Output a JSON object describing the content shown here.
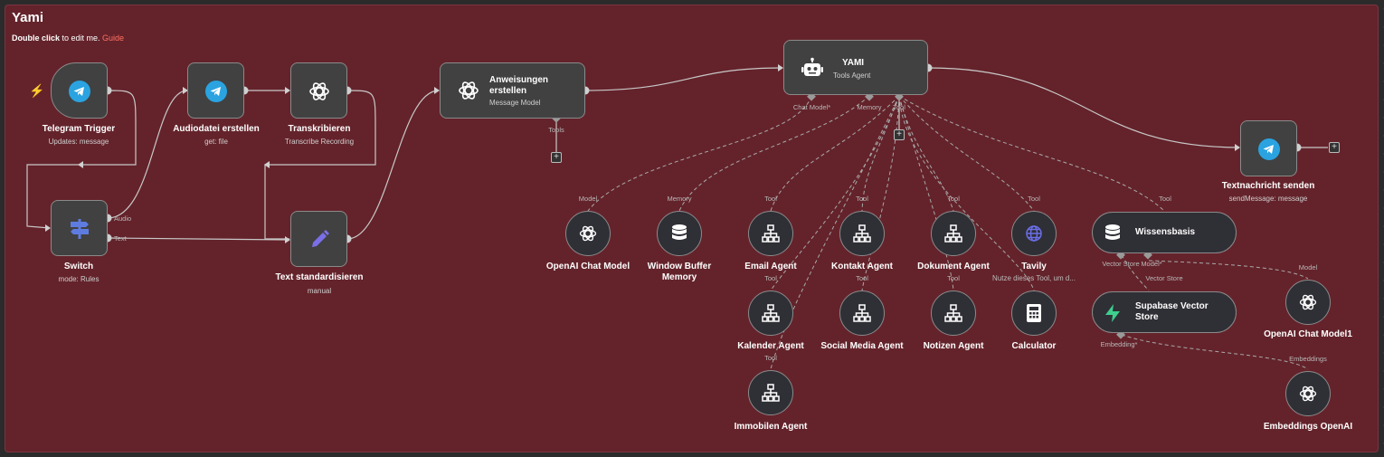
{
  "sticky": {
    "title": "Yami",
    "sub_prefix_bold": "Double click",
    "sub_middle": " to edit me. ",
    "sub_link": "Guide"
  },
  "nodes": {
    "telegram_trigger": {
      "label": "Telegram Trigger",
      "sub": "Updates: message"
    },
    "audiodatei": {
      "label": "Audiodatei erstellen",
      "sub": "get: file"
    },
    "transkribieren": {
      "label": "Transkribieren",
      "sub": "Transcribe Recording"
    },
    "switch": {
      "label": "Switch",
      "sub": "mode: Rules",
      "out_audio": "Audio",
      "out_text": "Text"
    },
    "text_std": {
      "label": "Text standardisieren",
      "sub": "manual"
    },
    "anweisungen": {
      "label": "Anweisungen erstellen",
      "sub": "Message Model",
      "port_tools": "Tools"
    },
    "yami": {
      "label": "YAMI",
      "sub": "Tools Agent",
      "port_chat": "Chat Model*",
      "port_memory": "Memory",
      "port_tool": "Tool"
    },
    "textnachricht": {
      "label": "Textnachricht senden",
      "sub": "sendMessage: message"
    },
    "openai_chat": {
      "label": "OpenAI Chat Model",
      "port": "Model"
    },
    "window_buffer": {
      "label": "Window Buffer Memory",
      "port": "Memory"
    },
    "email_agent": {
      "label": "Email Agent",
      "port": "Tool",
      "port_out": "Tool"
    },
    "kontakt_agent": {
      "label": "Kontakt Agent",
      "port": "Tool",
      "port_out": "Tool"
    },
    "dokument_agent": {
      "label": "Dokument Agent",
      "port": "Tool",
      "port_out": "Tool"
    },
    "tavily": {
      "label": "Tavily",
      "sub": "Nutze dieses Tool, um d...",
      "port": "Tool",
      "port_out": "Tool"
    },
    "wissensbasis": {
      "label": "Wissensbasis",
      "port": "Tool",
      "port_vs": "Vector Store",
      "port_model": "Model*"
    },
    "kalender_agent": {
      "label": "Kalender Agent",
      "port": "Tool"
    },
    "social_media": {
      "label": "Social Media Agent"
    },
    "notizen_agent": {
      "label": "Notizen Agent"
    },
    "calculator": {
      "label": "Calculator"
    },
    "supabase": {
      "label": "Supabase Vector Store",
      "port": "Vector Store",
      "port_emb": "Embedding*"
    },
    "openai_chat1": {
      "label": "OpenAI Chat Model1",
      "port": "Model"
    },
    "immobilen": {
      "label": "Immobilen Agent",
      "port": "Tool"
    },
    "embeddings": {
      "label": "Embeddings OpenAI",
      "port": "Embeddings"
    }
  },
  "colors": {
    "sticky_bg": "#64232b",
    "telegram": "#2aa3e0",
    "switch": "#5e7ce0",
    "pencil": "#7b6fe8",
    "supabase": "#3ecf8e",
    "tavily": "#6b6fe6",
    "trigger_bolt": "#ff5533"
  }
}
